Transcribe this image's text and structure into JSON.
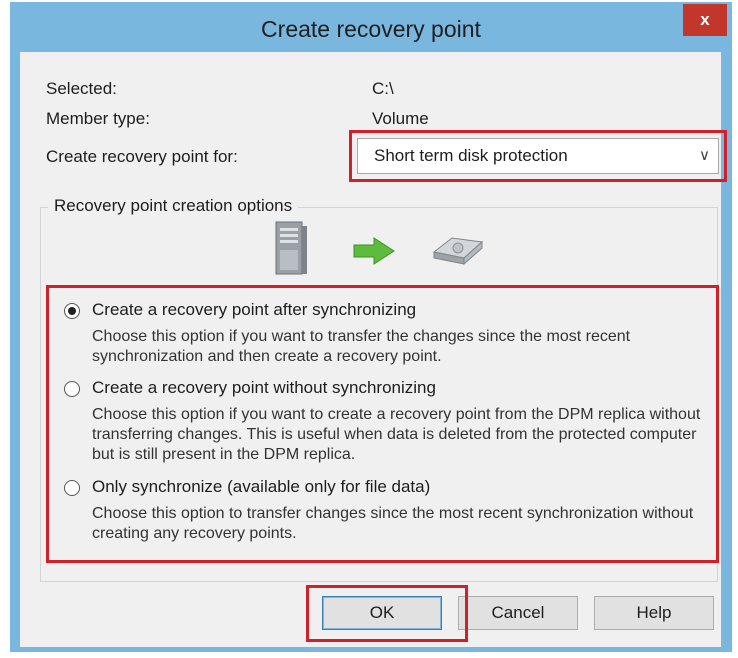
{
  "dialog": {
    "title": "Create recovery point",
    "close_label": "x"
  },
  "fields": {
    "selected_label": "Selected:",
    "selected_value": "C:\\",
    "member_type_label": "Member type:",
    "member_type_value": "Volume",
    "create_for_label": "Create recovery point for:",
    "create_for_value": "Short term disk protection"
  },
  "options_group": {
    "legend": "Recovery point creation options",
    "options": [
      {
        "title": "Create a recovery point after synchronizing",
        "description": "Choose this option if you want to transfer the changes since the most recent synchronization and then create a recovery point.",
        "selected": true
      },
      {
        "title": "Create a recovery point without synchronizing",
        "description": "Choose this option if you want to create a recovery point from the DPM replica without transferring changes. This is useful when data is deleted from the protected computer but is still present in the DPM replica.",
        "selected": false
      },
      {
        "title": "Only synchronize (available only for file data)",
        "description": "Choose this option to transfer changes since the most recent synchronization without creating any recovery points.",
        "selected": false
      }
    ],
    "icons": [
      "server-icon",
      "arrow-right-icon",
      "disk-drive-icon"
    ]
  },
  "buttons": {
    "ok": "OK",
    "cancel": "Cancel",
    "help": "Help"
  },
  "colors": {
    "title_bar": "#79b7df",
    "close_button": "#c2362b",
    "highlight": "#d0202a",
    "arrow": "#5cbd3c"
  }
}
